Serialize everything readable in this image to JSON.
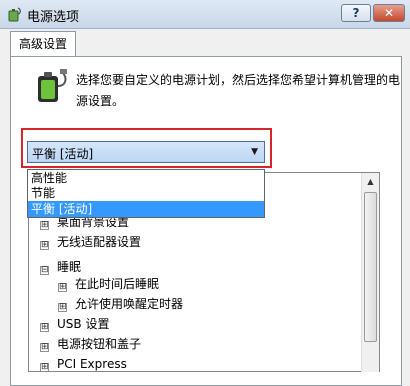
{
  "window": {
    "title": "电源选项",
    "help_label": "?",
    "close_label": "✕",
    "icon": "power-options-icon"
  },
  "tab": {
    "label": "高级设置"
  },
  "description": "选择您要自定义的电源计划，然后选择您希望计算机管理的电源设置。",
  "plan_select": {
    "value": "平衡 [活动]",
    "options": [
      "高性能",
      "节能",
      "平衡 [活动]"
    ],
    "selected_index": 2
  },
  "tree": {
    "items": [
      {
        "label": "桌面背景设置",
        "expander": "⊞",
        "level": 0
      },
      {
        "label": "无线适配器设置",
        "expander": "⊞",
        "level": 0
      },
      {
        "label": "睡眠",
        "expander": "⊟",
        "level": 0
      },
      {
        "label": "在此时间后睡眠",
        "expander": "⊞",
        "level": 1
      },
      {
        "label": "允许使用唤醒定时器",
        "expander": "⊞",
        "level": 1
      },
      {
        "label": "USB 设置",
        "expander": "⊞",
        "level": 0
      },
      {
        "label": "电源按钮和盖子",
        "expander": "⊞",
        "level": 0
      },
      {
        "label": "PCI Express",
        "expander": "⊞",
        "level": 0
      }
    ]
  },
  "colors": {
    "highlight_border": "#d6262b",
    "selection": "#3399ff"
  }
}
